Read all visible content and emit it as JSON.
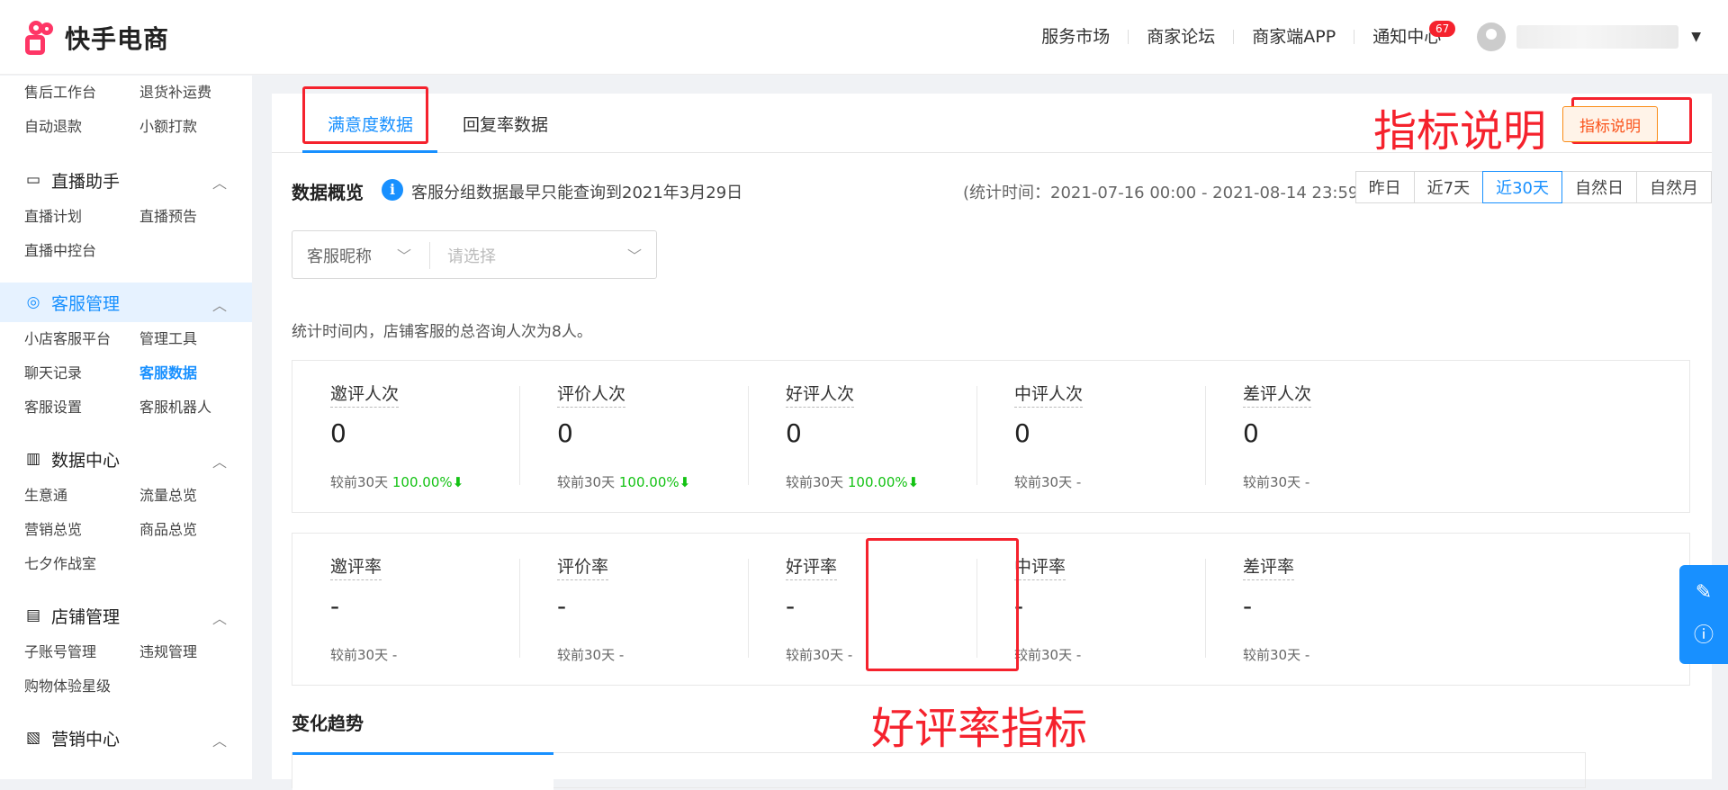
{
  "header": {
    "logo_text": "快手电商",
    "nav": [
      "服务市场",
      "商家论坛",
      "商家端APP",
      "通知中心"
    ],
    "notice_badge": "67",
    "brand_color": "#fe3666"
  },
  "sidebar": {
    "top_items": [
      "售后工作台",
      "退货补运费",
      "自动退款",
      "小额打款"
    ],
    "groups": [
      {
        "title": "直播助手",
        "icon": "video-icon",
        "items": [
          "直播计划",
          "直播预告",
          "直播中控台"
        ]
      },
      {
        "title": "客服管理",
        "icon": "chat-icon",
        "active": true,
        "items": [
          "小店客服平台",
          "管理工具",
          "聊天记录",
          "客服数据",
          "客服设置",
          "客服机器人"
        ]
      },
      {
        "title": "数据中心",
        "icon": "bar-chart-icon",
        "items": [
          "生意通",
          "流量总览",
          "营销总览",
          "商品总览",
          "七夕作战室"
        ]
      },
      {
        "title": "店铺管理",
        "icon": "store-icon",
        "items": [
          "子账号管理",
          "违规管理",
          "购物体验星级"
        ]
      },
      {
        "title": "营销中心",
        "icon": "trend-icon",
        "items": []
      }
    ]
  },
  "tabs": [
    "满意度数据",
    "回复率数据"
  ],
  "metric_button": "指标说明",
  "annotations": {
    "metric_explain": "指标说明",
    "good_rate": "好评率指标"
  },
  "overview": {
    "title": "数据概览",
    "info": "客服分组数据最早只能查询到2021年3月29日",
    "stat_time": "(统计时间：2021-07-16 00:00 - 2021-08-14 23:59)",
    "ranges": [
      "昨日",
      "近7天",
      "近30天",
      "自然日",
      "自然月"
    ],
    "active_range": "近30天"
  },
  "filter": {
    "label": "客服昵称",
    "placeholder": "请选择"
  },
  "summary": "统计时间内，店铺客服的总咨询人次为8人。",
  "metrics_row1": [
    {
      "name": "邀评人次",
      "value": "0",
      "compare_label": "较前30天",
      "change": "100.00%",
      "down": true
    },
    {
      "name": "评价人次",
      "value": "0",
      "compare_label": "较前30天",
      "change": "100.00%",
      "down": true
    },
    {
      "name": "好评人次",
      "value": "0",
      "compare_label": "较前30天",
      "change": "100.00%",
      "down": true
    },
    {
      "name": "中评人次",
      "value": "0",
      "compare_label": "较前30天",
      "change": "-",
      "down": false
    },
    {
      "name": "差评人次",
      "value": "0",
      "compare_label": "较前30天",
      "change": "-",
      "down": false
    }
  ],
  "metrics_row2": [
    {
      "name": "邀评率",
      "value": "-",
      "compare_label": "较前30天",
      "change": "-"
    },
    {
      "name": "评价率",
      "value": "-",
      "compare_label": "较前30天",
      "change": "-"
    },
    {
      "name": "好评率",
      "value": "-",
      "compare_label": "较前30天",
      "change": "-"
    },
    {
      "name": "中评率",
      "value": "-",
      "compare_label": "较前30天",
      "change": "-"
    },
    {
      "name": "差评率",
      "value": "-",
      "compare_label": "较前30天",
      "change": "-"
    }
  ],
  "trend_title": "变化趋势",
  "colors": {
    "accent": "#1890ff",
    "annotation": "#f5222d",
    "up": "#13c213"
  }
}
